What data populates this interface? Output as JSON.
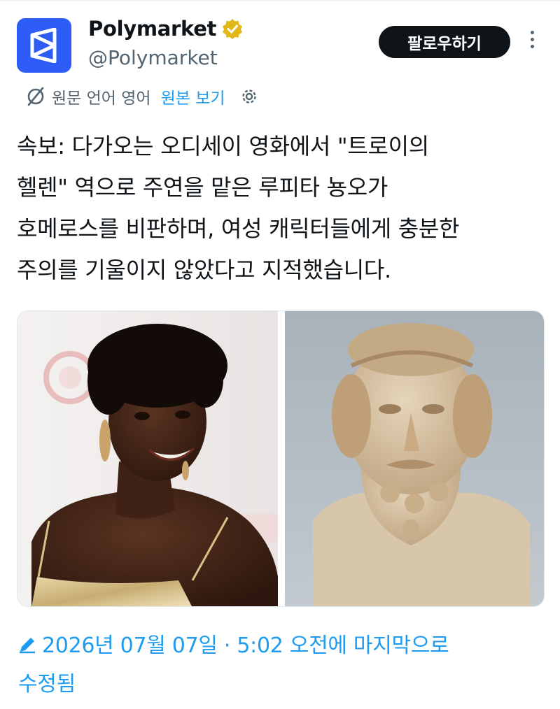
{
  "account": {
    "display_name": "Polymarket",
    "handle": "@Polymarket",
    "verified_icon": "gold-verified-badge-icon",
    "avatar_icon": "polymarket-logo-icon",
    "brand_color": "#2e5cf6",
    "badge_color": "#e2b719"
  },
  "actions": {
    "follow_label": "팔로우하기",
    "more_icon": "more-vertical-icon"
  },
  "translation": {
    "label": "원문 언어 영어",
    "link": "원본 보기",
    "translate_icon": "translate-off-icon",
    "settings_icon": "gear-icon"
  },
  "tweet": {
    "lines": [
      "속보: 다가오는 오디세이 영화에서 \"트로이의",
      "헬렌\" 역으로 주연을 맡은 루피타 뇽오가",
      "호메로스를 비판하며, 여성 캐릭터들에게 충분한",
      "주의를 기울이지 않았다고 지적했습니다."
    ]
  },
  "media": {
    "left_image": "Portrait of a smiling woman with short natural hair and large earrings",
    "right_image": "Ancient marble bust of a bearded man"
  },
  "edited": {
    "icon": "pencil-icon",
    "line1": "2026년 07월 07일 · 5:02 오전에 마지막으로",
    "line2": "수정됨"
  },
  "colors": {
    "link": "#1d9bf0",
    "secondary_text": "#536471",
    "primary_text": "#0f1419"
  }
}
